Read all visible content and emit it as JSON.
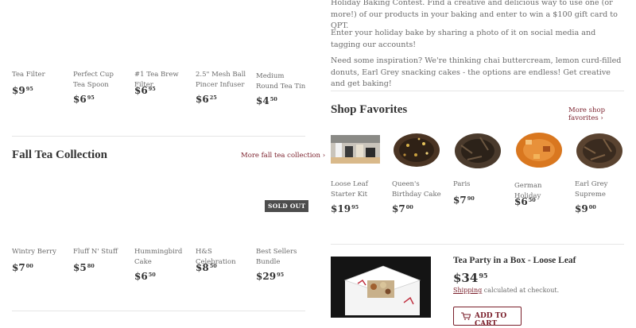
{
  "top_products": [
    {
      "name": "Tea Filter",
      "price_main": "$9",
      "price_cents": "95"
    },
    {
      "name": "Perfect Cup Tea Spoon",
      "price_main": "$6",
      "price_cents": "95"
    },
    {
      "name": "#1 Tea Brew Filter",
      "price_main": "$6",
      "price_cents": "95"
    },
    {
      "name": "2.5\" Mesh Ball Pincer Infuser",
      "price_main": "$6",
      "price_cents": "25"
    },
    {
      "name": "Medium Round Tea Tin",
      "price_main": "$4",
      "price_cents": "50"
    }
  ],
  "fall": {
    "title": "Fall Tea Collection",
    "more_link": "More fall tea collection ›",
    "sold_out_badge": "SOLD OUT",
    "products": [
      {
        "name": "Wintry Berry",
        "price_main": "$7",
        "price_cents": "00"
      },
      {
        "name": "Fluff N' Stuff",
        "price_main": "$5",
        "price_cents": "80"
      },
      {
        "name": "Hummingbird Cake",
        "price_main": "$6",
        "price_cents": "50"
      },
      {
        "name": "H&S Celebration",
        "price_main": "$8",
        "price_cents": "50"
      },
      {
        "name": "Best Sellers Bundle",
        "price_main": "$29",
        "price_cents": "95"
      }
    ]
  },
  "contest": {
    "para1": "Holiday Baking Contest. Find a creative and delicious way to use one (or more!) of our products in your baking and enter to win a $100 gift card to QPT.",
    "para2": "Enter your holiday bake by sharing a photo of it on social media and tagging our accounts!",
    "para3": "Need some inspiration? We're thinking chai buttercream, lemon curd-filled donuts, Earl Grey snacking cakes - the options are endless! Get creative and get baking!"
  },
  "favorites": {
    "title": "Shop Favorites",
    "more_link": "More shop favorites ›",
    "products": [
      {
        "name": "Loose Leaf Starter Kit",
        "price_main": "$19",
        "price_cents": "95"
      },
      {
        "name": "Queen's Birthday Cake",
        "price_main": "$7",
        "price_cents": "00"
      },
      {
        "name": "Paris",
        "price_main": "$7",
        "price_cents": "90"
      },
      {
        "name": "German Holiday",
        "price_main": "$6",
        "price_cents": "50"
      },
      {
        "name": "Earl Grey Supreme",
        "price_main": "$9",
        "price_cents": "00"
      }
    ]
  },
  "featured": {
    "title": "Tea Party in a Box - Loose Leaf",
    "price_main": "$34",
    "price_cents": "95",
    "shipping_link": "Shipping",
    "shipping_text": " calculated at checkout.",
    "add_to_cart": "ADD TO CART"
  },
  "colors": {
    "accent": "#7a1f2b",
    "badge": "#4d4d4d"
  }
}
